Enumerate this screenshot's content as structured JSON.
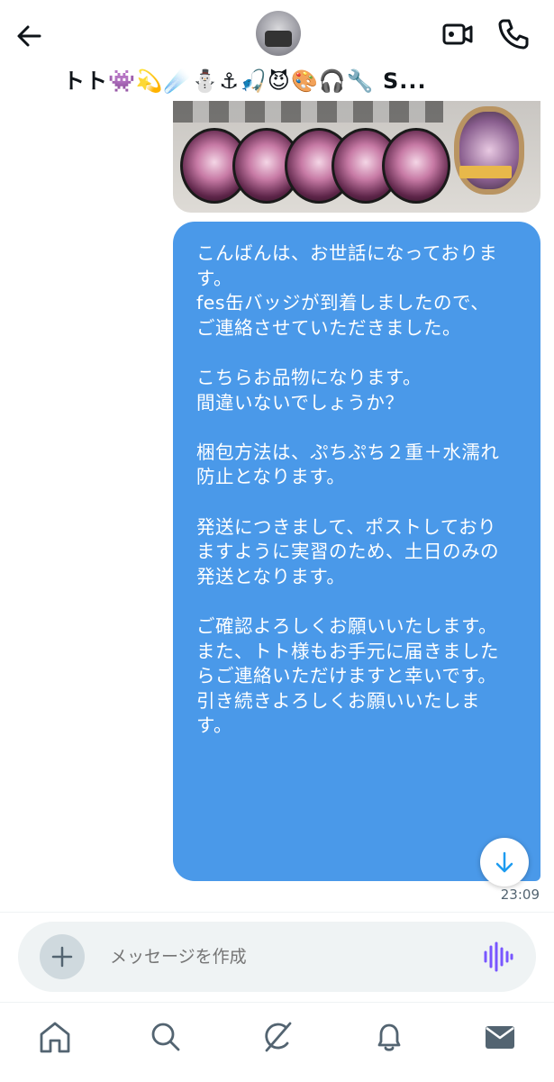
{
  "header": {
    "title": "トト👾💫☄️⛄⚓🎣😈🎨🎧🔧 S...",
    "icons": {
      "back": "arrow-left-icon",
      "video": "video-camera-icon",
      "phone": "phone-icon"
    }
  },
  "conversation": {
    "message_text": "こんばんは、お世話になっております。\nfes缶バッジが到着しましたので、ご連絡させていただきました。\n\nこちらお品物になります。\n間違いないでしょうか？\n\n梱包方法は、ぷちぷち２重＋水濡れ防止となります。\n\n発送につきまして、ポストしておりますように実習のため、土日のみの発送となります。\n\nご確認よろしくお願いいたします。\nまた、トト様もお手元に届きましたらご連絡いただけますと幸いです。\n引き続きよろしくお願いいたします。",
    "timestamp": "23:09",
    "bubble_color": "#4a99e9"
  },
  "composer": {
    "placeholder": "メッセージを作成",
    "add_icon": "plus-icon",
    "voice_icon": "voice-waveform-icon",
    "voice_color": "#7856ff"
  },
  "bottom_nav": [
    "home-icon",
    "search-icon",
    "grok-icon",
    "notifications-icon",
    "messages-icon"
  ]
}
